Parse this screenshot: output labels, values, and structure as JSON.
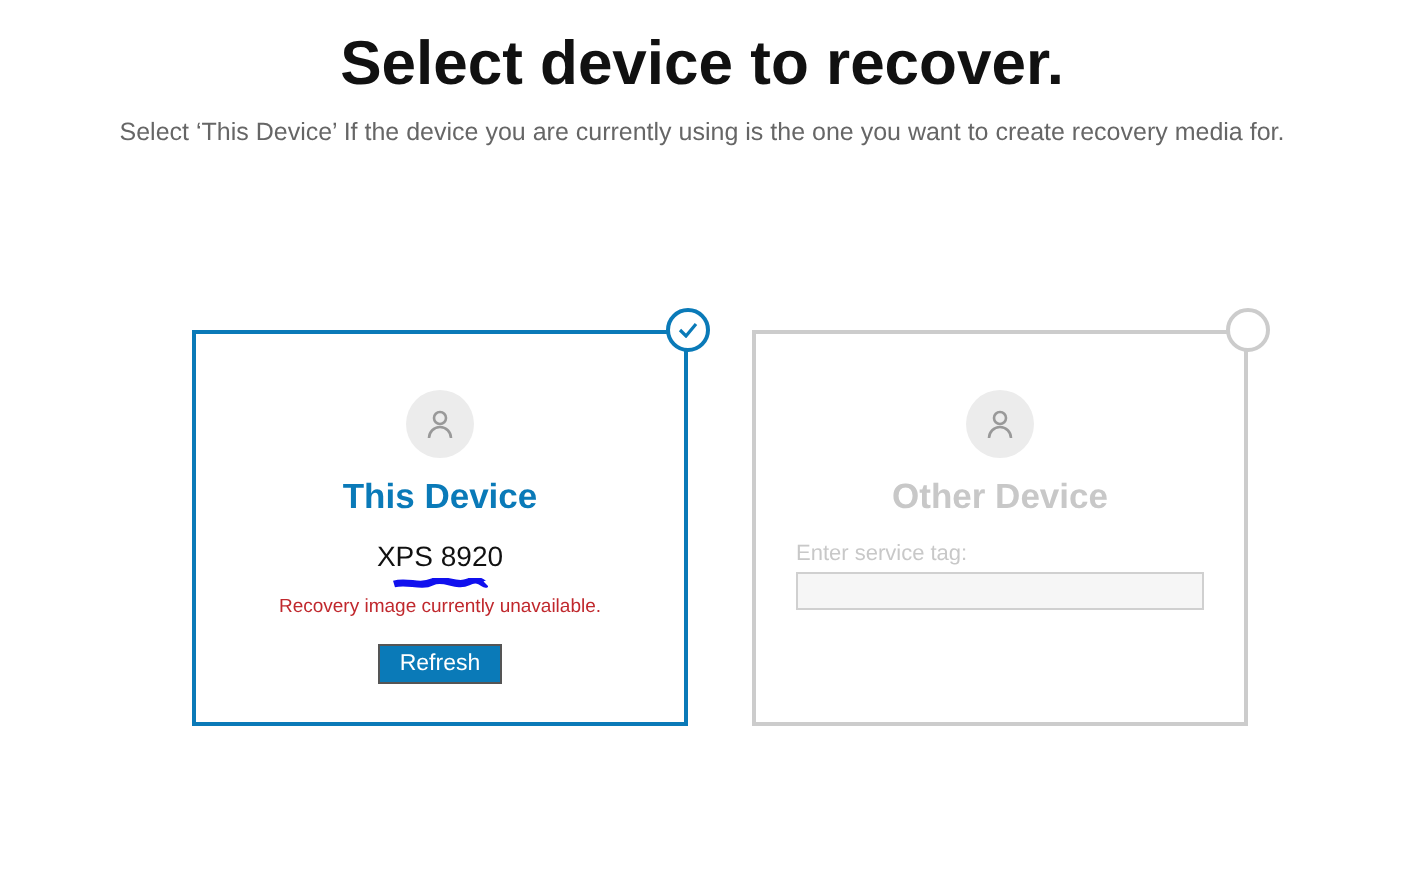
{
  "title": "Select device to recover.",
  "subtitle": "Select ‘This Device’ If the device you are currently using is the one you want to create recovery media for.",
  "devices": [
    {
      "kind": "current",
      "selected": true,
      "title": "This Device",
      "model": "XPS 8920",
      "message": "Recovery image currently unavailable.",
      "button": "Refresh"
    },
    {
      "kind": "other",
      "selected": false,
      "title": "Other Device",
      "field_label": "Enter service tag:"
    }
  ]
}
